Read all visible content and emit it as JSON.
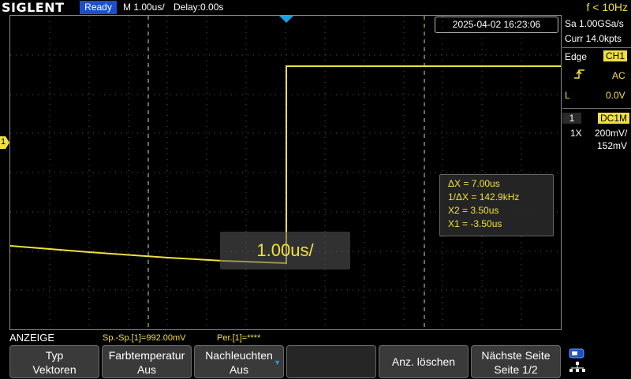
{
  "header": {
    "brand": "SIGLENT",
    "status": "Ready",
    "timebase": "M 1.00us/",
    "delay": "Delay:0.00s",
    "freq_counter": "f < 10Hz"
  },
  "datetime": "2025-04-02 16:23:06",
  "acquisition": {
    "sample_rate": "Sa 1.00GSa/s",
    "memory": "Curr 14.0kpts"
  },
  "trigger": {
    "type": "Edge",
    "source": "CH1",
    "slope_icon": "rising-edge-icon",
    "coupling": "AC",
    "mode": "L",
    "level": "0.0V"
  },
  "channel": {
    "number": "1",
    "coupling": "DC1M",
    "probe": "1X",
    "scale": "200mV/",
    "offset": "152mV",
    "marker": "1"
  },
  "cursor": {
    "delta_x": "ΔX = 7.00us",
    "inv_delta_x": "1/ΔX = 142.9kHz",
    "x2": "X2 = 3.50us",
    "x1": "X1 = -3.50us"
  },
  "timebase_overlay": "1.00us/",
  "bottom": {
    "menu_title": "ANZEIGE",
    "meas_pkpk": "Sp.-Sp.[1]=992.00mV",
    "meas_period": "Per.[1]=****",
    "softkeys": [
      {
        "line1": "Typ",
        "line2": "Vektoren"
      },
      {
        "line1": "Farbtemperatur",
        "line2": "Aus"
      },
      {
        "line1": "Nachleuchten",
        "line2": "Aus"
      },
      {
        "line1": "Anz. löschen",
        "line2": ""
      },
      {
        "line1": "Nächste Seite",
        "line2": "Seite 1/2"
      }
    ]
  },
  "colors": {
    "trace": "#f0e040",
    "status_bg": "#1e4fc9",
    "trigger_marker": "#1aa0e0"
  }
}
